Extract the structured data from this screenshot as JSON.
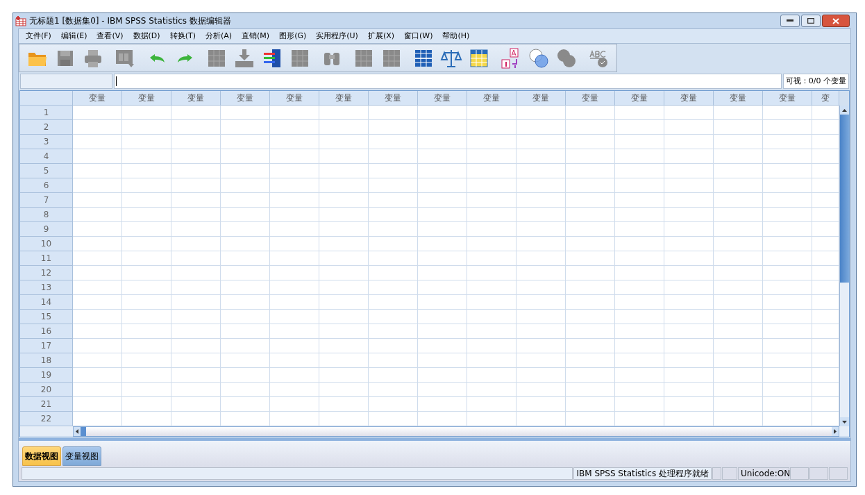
{
  "window": {
    "title": "无标题1 [数据集0] - IBM SPSS Statistics 数据编辑器"
  },
  "menu": [
    "文件(F)",
    "编辑(E)",
    "查看(V)",
    "数据(D)",
    "转换(T)",
    "分析(A)",
    "直销(M)",
    "图形(G)",
    "实用程序(U)",
    "扩展(X)",
    "窗口(W)",
    "帮助(H)"
  ],
  "toolbar": [
    [
      {
        "kind": "open",
        "disabled": false
      },
      {
        "kind": "save",
        "disabled": true
      },
      {
        "kind": "print",
        "disabled": true
      }
    ],
    [
      {
        "kind": "recall",
        "disabled": true
      }
    ],
    [
      {
        "kind": "undo",
        "disabled": false
      },
      {
        "kind": "redo",
        "disabled": false
      }
    ],
    [
      {
        "kind": "goto_case",
        "disabled": true
      },
      {
        "kind": "goto_variable",
        "disabled": true
      },
      {
        "kind": "variables",
        "disabled": false
      },
      {
        "kind": "descriptives",
        "disabled": true
      }
    ],
    [
      {
        "kind": "find",
        "disabled": true
      }
    ],
    [
      {
        "kind": "insert_cases",
        "disabled": true
      },
      {
        "kind": "insert_variable",
        "disabled": true
      }
    ],
    [
      {
        "kind": "split",
        "disabled": false
      },
      {
        "kind": "weight",
        "disabled": false
      },
      {
        "kind": "select",
        "disabled": false
      }
    ],
    [
      {
        "kind": "value_labels",
        "disabled": false
      },
      {
        "kind": "use_sets",
        "disabled": false
      },
      {
        "kind": "show_all",
        "disabled": true
      }
    ],
    [
      {
        "kind": "spell",
        "disabled": true
      }
    ]
  ],
  "visible_count": "可视：0/0 个变量",
  "grid": {
    "columns": [
      "变量",
      "变量",
      "变量",
      "变量",
      "变量",
      "变量",
      "变量",
      "变量",
      "变量",
      "变量",
      "变量",
      "变量",
      "变量",
      "变量",
      "变量",
      "变"
    ],
    "rows": [
      "1",
      "2",
      "3",
      "4",
      "5",
      "6",
      "7",
      "8",
      "9",
      "10",
      "11",
      "12",
      "13",
      "14",
      "15",
      "16",
      "17",
      "18",
      "19",
      "20",
      "21",
      "22"
    ]
  },
  "tabs": [
    {
      "label": "数据视图",
      "selected": true
    },
    {
      "label": "变量视图",
      "selected": false
    }
  ],
  "status_bar": {
    "message": "IBM SPSS Statistics 处理程序就绪",
    "unicode": "Unicode:ON"
  }
}
